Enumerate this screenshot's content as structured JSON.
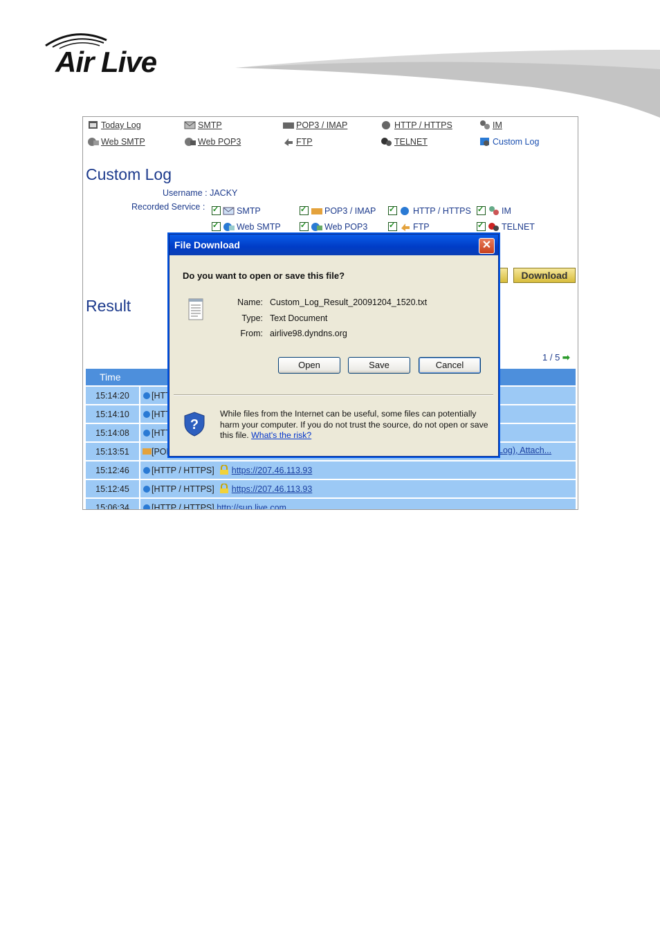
{
  "brand": {
    "logo": "Air Live"
  },
  "nav": [
    {
      "label": "Today Log",
      "icon": "calendar-icon"
    },
    {
      "label": "SMTP",
      "icon": "envelope-icon"
    },
    {
      "label": "POP3 / IMAP",
      "icon": "mail-receive-icon"
    },
    {
      "label": "HTTP / HTTPS",
      "icon": "globe-icon"
    },
    {
      "label": "IM",
      "icon": "people-icon"
    },
    {
      "label": "Web SMTP",
      "icon": "web-mail-send-icon"
    },
    {
      "label": "Web POP3",
      "icon": "web-mail-receive-icon"
    },
    {
      "label": "FTP",
      "icon": "ftp-icon"
    },
    {
      "label": "TELNET",
      "icon": "telnet-icon"
    },
    {
      "label": "Custom Log",
      "icon": "custom-log-icon",
      "active": true
    }
  ],
  "page": {
    "title": "Custom Log",
    "username_label": "Username :",
    "username_value": "JACKY",
    "recorded_label": "Recorded Service :",
    "services": [
      "SMTP",
      "POP3 / IMAP",
      "HTTP / HTTPS",
      "IM",
      "Web SMTP",
      "Web POP3",
      "FTP",
      "TELNET"
    ],
    "download_label": "Download",
    "result_title": "Result",
    "pager": "1 / 5"
  },
  "table": {
    "headers": [
      "Time",
      ""
    ],
    "rows": [
      {
        "time": "15:14:20",
        "proto": "[HTT",
        "url": ""
      },
      {
        "time": "15:14:10",
        "proto": "[HTT",
        "url": ""
      },
      {
        "time": "15:14:08",
        "proto": "[HTT",
        "url": ""
      },
      {
        "time": "15:13:51",
        "proto": "[POF",
        "url": "",
        "tail": "Log), Attach..."
      },
      {
        "time": "15:12:46",
        "proto": "[HTTP / HTTPS]",
        "url": "https://207.46.113.93",
        "lock": true
      },
      {
        "time": "15:12:45",
        "proto": "[HTTP / HTTPS]",
        "url": "https://207.46.113.93",
        "lock": true
      },
      {
        "time": "15:06:34",
        "proto": "[HTTP / HTTPS]",
        "url": "http://sup.live.com"
      }
    ]
  },
  "dialog": {
    "title": "File Download",
    "question": "Do you want to open or save this file?",
    "name_label": "Name:",
    "name_value": "Custom_Log_Result_20091204_1520.txt",
    "type_label": "Type:",
    "type_value": "Text Document",
    "from_label": "From:",
    "from_value": "airlive98.dyndns.org",
    "open_label": "Open",
    "save_label": "Save",
    "cancel_label": "Cancel",
    "warning": "While files from the Internet can be useful, some files can potentially harm your computer. If you do not trust the source, do not open or save this file.",
    "risk_link": "What's the risk?"
  }
}
